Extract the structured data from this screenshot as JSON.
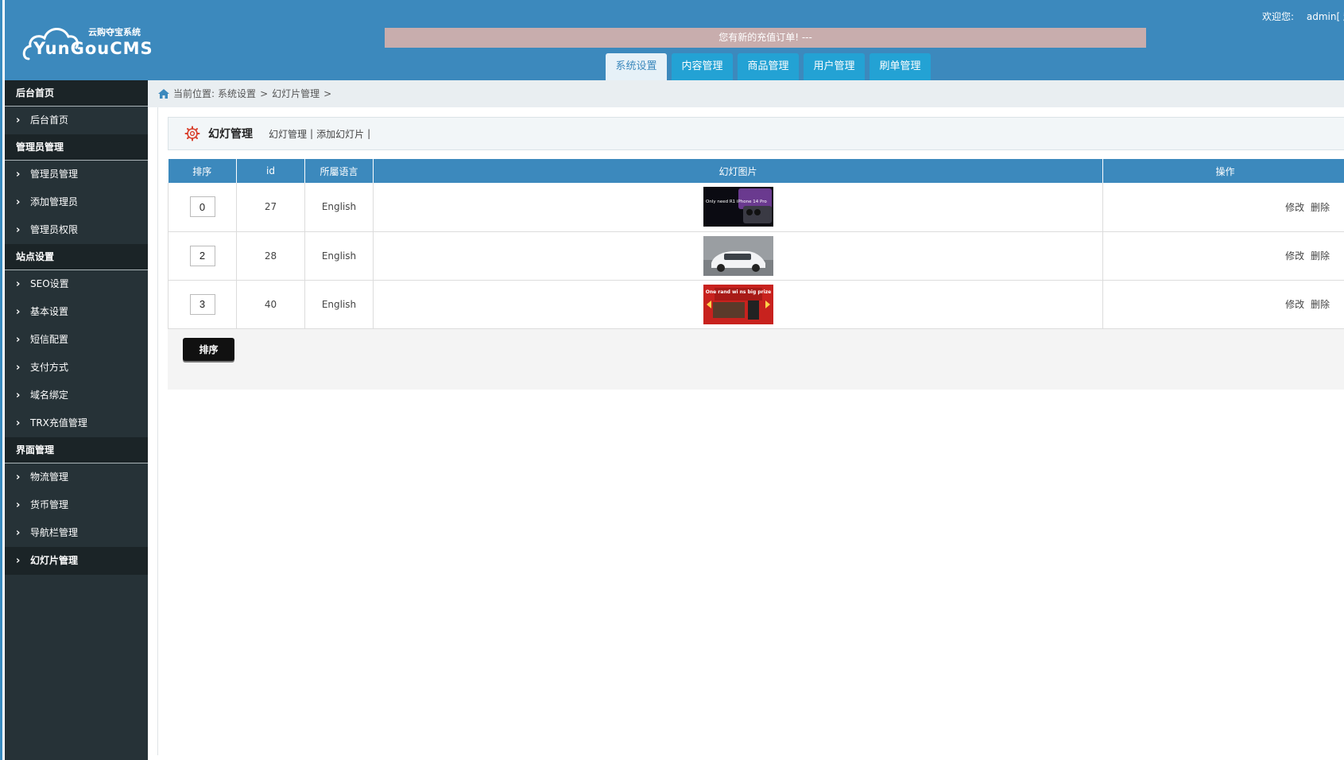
{
  "logo": {
    "sub": "云购夺宝系统",
    "main": "YunGouCMS"
  },
  "header": {
    "notice": "您有新的充值订单! ---",
    "welcome_label": "欢迎您:",
    "user": "admin[ 超"
  },
  "topnav": [
    {
      "label": "系统设置",
      "active": true
    },
    {
      "label": "内容管理"
    },
    {
      "label": "商品管理"
    },
    {
      "label": "用户管理"
    },
    {
      "label": "刷单管理"
    }
  ],
  "sidebar": {
    "groups": [
      {
        "head": "后台首页",
        "items": [
          "后台首页"
        ]
      },
      {
        "head": "管理员管理",
        "items": [
          "管理员管理",
          "添加管理员",
          "管理员权限"
        ]
      },
      {
        "head": "站点设置",
        "items": [
          "SEO设置",
          "基本设置",
          "短信配置",
          "支付方式",
          "域名绑定",
          "TRX充值管理"
        ]
      },
      {
        "head": "界面管理",
        "items": [
          "物流管理",
          "货币管理",
          "导航栏管理",
          "幻灯片管理"
        ]
      }
    ],
    "active_item": "幻灯片管理"
  },
  "breadcrumb": {
    "prefix": "当前位置:",
    "path": [
      "系统设置",
      "幻灯片管理"
    ],
    "sep": ">"
  },
  "panel": {
    "title": "幻灯管理",
    "links": [
      "幻灯管理",
      "添加幻灯片"
    ],
    "link_sep": "|"
  },
  "table": {
    "headers": [
      "排序",
      "id",
      "所屬语言",
      "幻灯图片",
      "操作"
    ],
    "rows": [
      {
        "order": "0",
        "id": "27",
        "lang": "English",
        "image": "iphone-14-pro-banner",
        "image_text": "Only need R1 iPhone 14 Pro"
      },
      {
        "order": "2",
        "id": "28",
        "lang": "English",
        "image": "white-car-banner",
        "image_text": ""
      },
      {
        "order": "3",
        "id": "40",
        "lang": "English",
        "image": "prize-banner",
        "image_text": "One rand wi ns big prize"
      }
    ],
    "op_edit": "修改",
    "op_delete": "删除"
  },
  "sort_button": "排序",
  "colors": {
    "header": "#3c89bd",
    "tab": "#23a2d4",
    "sidebar": "#263237",
    "sidebar_head": "#1b2427",
    "notice": "#c8adad"
  }
}
